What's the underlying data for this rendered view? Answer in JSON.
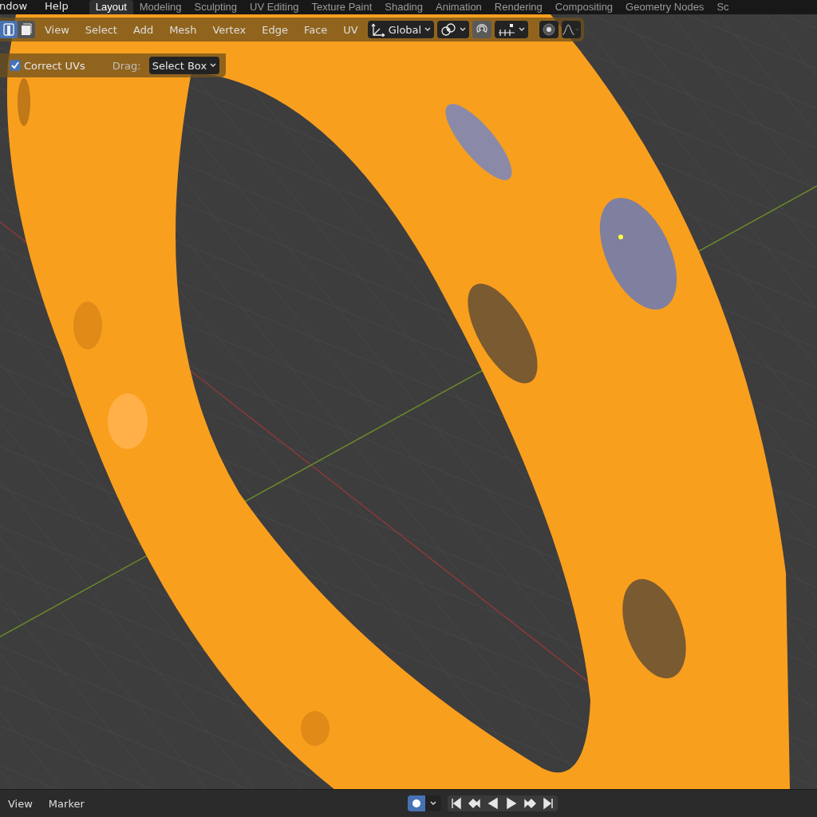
{
  "topbar": {
    "menus": [
      "ndow",
      "Help"
    ],
    "workspace_tabs": [
      {
        "label": "Layout",
        "selected": true
      },
      {
        "label": "Modeling",
        "selected": false
      },
      {
        "label": "Sculpting",
        "selected": false
      },
      {
        "label": "UV Editing",
        "selected": false
      },
      {
        "label": "Texture Paint",
        "selected": false
      },
      {
        "label": "Shading",
        "selected": false
      },
      {
        "label": "Animation",
        "selected": false
      },
      {
        "label": "Rendering",
        "selected": false
      },
      {
        "label": "Compositing",
        "selected": false
      },
      {
        "label": "Geometry Nodes",
        "selected": false
      },
      {
        "label": "Sc",
        "selected": false
      }
    ]
  },
  "viewport_header": {
    "select_mode": [
      {
        "selected": true
      },
      {
        "selected": false
      }
    ],
    "menus": [
      "View",
      "Select",
      "Add",
      "Mesh",
      "Vertex",
      "Edge",
      "Face",
      "UV"
    ],
    "orientation": "Global",
    "snap": {
      "on": true
    },
    "proportional_editing": {
      "on": false
    }
  },
  "operator_panel": {
    "correct_uvs": {
      "label": "Correct UVs",
      "checked": true
    },
    "drag_label": "Drag:",
    "drag_value": "Select Box"
  },
  "timeline": {
    "menus": [
      "View",
      "Marker"
    ],
    "auto_keying": {
      "on": true
    }
  }
}
